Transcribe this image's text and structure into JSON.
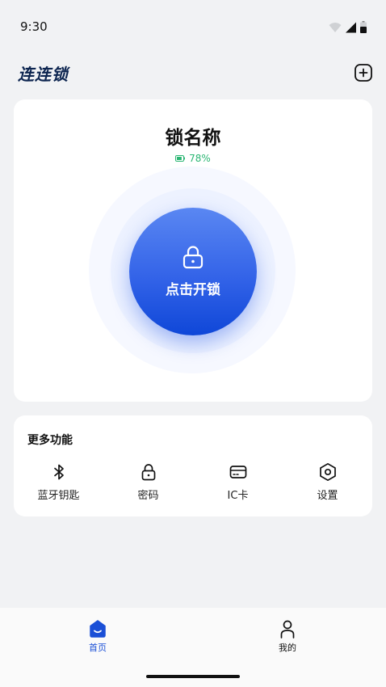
{
  "status_bar": {
    "time": "9:30"
  },
  "header": {
    "title": "连连锁"
  },
  "lock_card": {
    "lock_name": "锁名称",
    "battery": "78%",
    "battery_level": 0.78,
    "unlock_label": "点击开锁"
  },
  "more_functions": {
    "title": "更多功能",
    "items": [
      {
        "label": "蓝牙钥匙",
        "icon": "bluetooth-icon"
      },
      {
        "label": "密码",
        "icon": "lock-icon"
      },
      {
        "label": "IC卡",
        "icon": "card-icon"
      },
      {
        "label": "设置",
        "icon": "settings-icon"
      }
    ]
  },
  "bottom_nav": {
    "items": [
      {
        "label": "首页",
        "icon": "home-icon",
        "active": true
      },
      {
        "label": "我的",
        "icon": "profile-icon",
        "active": false
      }
    ]
  },
  "colors": {
    "accent": "#1a4fd6",
    "battery": "#2bb673",
    "title": "#0d2550"
  }
}
